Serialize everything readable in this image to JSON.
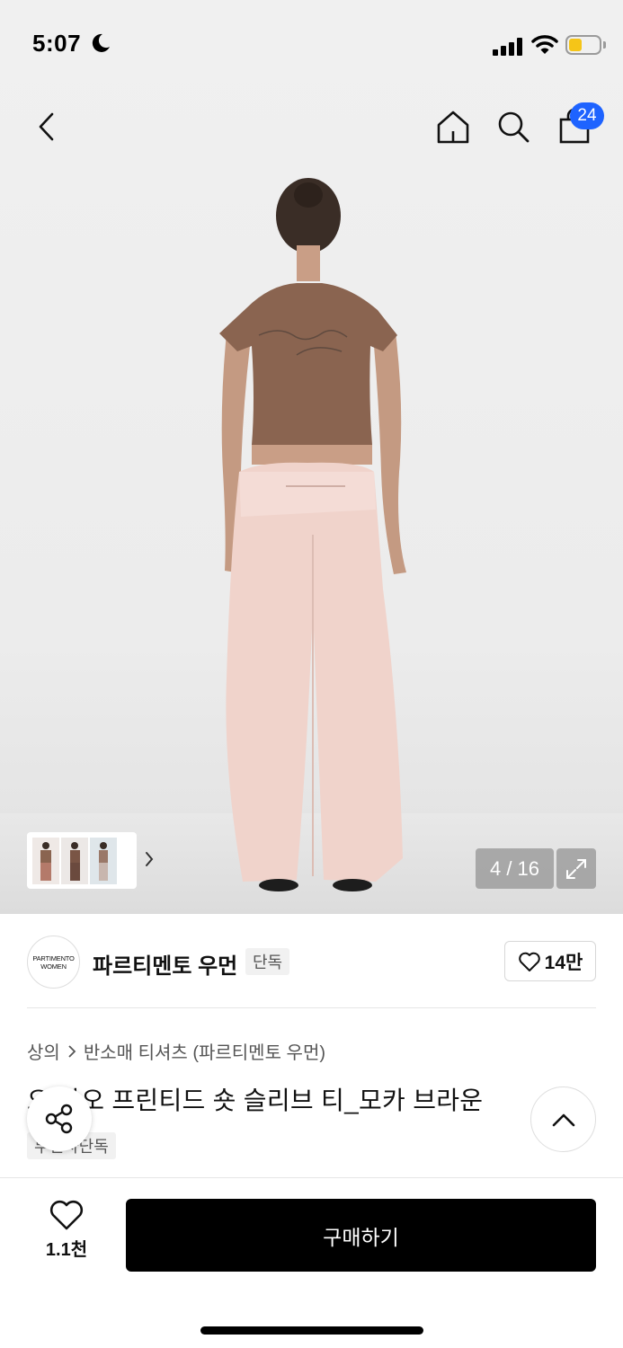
{
  "status_bar": {
    "time": "5:07"
  },
  "header": {
    "cart_count": "24"
  },
  "gallery": {
    "counter": "4 / 16"
  },
  "brand": {
    "logo_line1": "PARTIMENTO",
    "logo_line2": "WOMEN",
    "name": "파르티멘토 우먼",
    "tag": "단독",
    "likes": "14만"
  },
  "breadcrumb": {
    "category": "상의",
    "subcategory": "반소매 티셔츠 (파르티멘토 우먼)"
  },
  "product": {
    "title": "오 하오 프린티드 숏 슬리브 티_모카 브라운",
    "tag": "무신사단독"
  },
  "bottom_bar": {
    "wish_count": "1.1천",
    "buy_label": "구매하기"
  },
  "colors": {
    "accent_badge": "#1e63ff",
    "buy_button": "#000000",
    "shirt": "#8a6450",
    "pants": "#f0d3cb"
  },
  "icons": [
    "back-icon",
    "home-icon",
    "search-icon",
    "cart-icon",
    "chevron-right-icon",
    "expand-icon",
    "heart-icon",
    "share-icon",
    "chevron-up-icon"
  ]
}
